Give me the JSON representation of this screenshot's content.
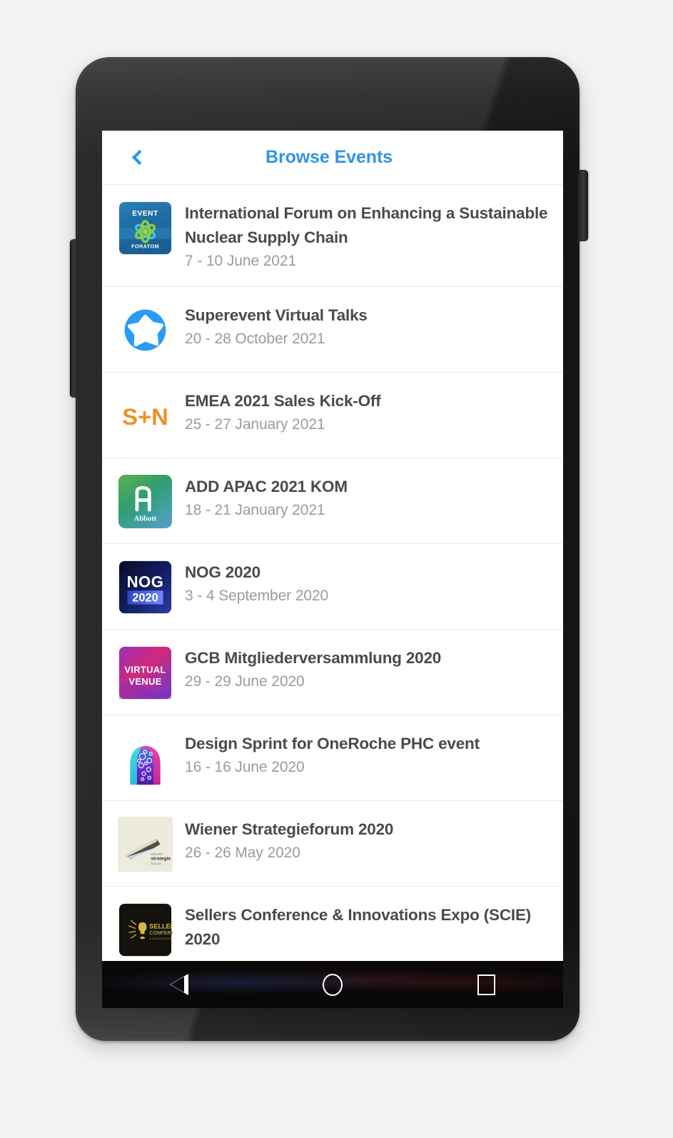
{
  "appbar": {
    "title": "Browse Events",
    "back_label": "Back",
    "title_color": "#3094ea",
    "back_icon_color": "#2196f3"
  },
  "navbar": {
    "back_label": "Back",
    "home_label": "Home",
    "recents_label": "Recent apps"
  },
  "events": [
    {
      "title": "International Forum on Enhancing a Sustainable Nuclear Supply Chain",
      "date": "7 - 10 June 2021",
      "icon": "foratom-event-logo",
      "icon_text_top": "EVENT",
      "icon_text_bottom": "FORATOM",
      "icon_colors": [
        "#1c6ca8",
        "#2f86bd",
        "#8fce3f",
        "#3fb8e0"
      ]
    },
    {
      "title": "Superevent Virtual Talks",
      "date": "20 - 28 October 2021",
      "icon": "superevent-star-logo",
      "icon_colors": [
        "#2b9bf4",
        "#ffffff"
      ]
    },
    {
      "title": "EMEA 2021 Sales Kick-Off",
      "date": "25 - 27 January 2021",
      "icon": "smith-nephew-logo",
      "icon_text": "S+N",
      "icon_colors": [
        "#ffffff",
        "#ef9026"
      ]
    },
    {
      "title": "ADD APAC 2021 KOM",
      "date": "18 - 21 January 2021",
      "icon": "abbott-logo",
      "icon_text": "Abbott",
      "icon_colors": [
        "#4aa64a",
        "#2e9e77",
        "#4e9fc4"
      ]
    },
    {
      "title": "NOG 2020",
      "date": "3 - 4 September 2020",
      "icon": "nog-2020-logo",
      "icon_text_top": "NOG",
      "icon_text_bottom": "2020",
      "icon_colors": [
        "#0b1030",
        "#1b2a86",
        "#4e6bf0"
      ]
    },
    {
      "title": "GCB Mitgliederversammlung 2020",
      "date": "29 - 29 June 2020",
      "icon": "virtual-venue-logo",
      "icon_text_top": "VIRTUAL",
      "icon_text_bottom": "VENUE",
      "icon_colors": [
        "#8e2fb0",
        "#d42a6e",
        "#6a3bd0"
      ]
    },
    {
      "title": "Design Sprint for OneRoche PHC event",
      "date": "16 - 16 June 2020",
      "icon": "dual-head-gears-logo",
      "icon_colors": [
        "#28d6d6",
        "#e0379e",
        "#5b2fd6",
        "#ffffff"
      ]
    },
    {
      "title": "Wiener Strategieforum 2020",
      "date": "26 - 26 May 2020",
      "icon": "wiener-strategieforum-logo",
      "icon_text_1": "wiener",
      "icon_text_2": "strategie",
      "icon_text_3": "forum",
      "icon_colors": [
        "#ebe9de",
        "#4a504c",
        "#e2dcc0"
      ]
    },
    {
      "title": "Sellers Conference & Innovations Expo (SCIE) 2020",
      "date": "",
      "icon": "sellers-conference-logo",
      "icon_text_1": "SELLERS",
      "icon_text_2": "CONFERENCE",
      "icon_colors": [
        "#15120e",
        "#d4b33a",
        "#8c9c3a"
      ]
    }
  ]
}
